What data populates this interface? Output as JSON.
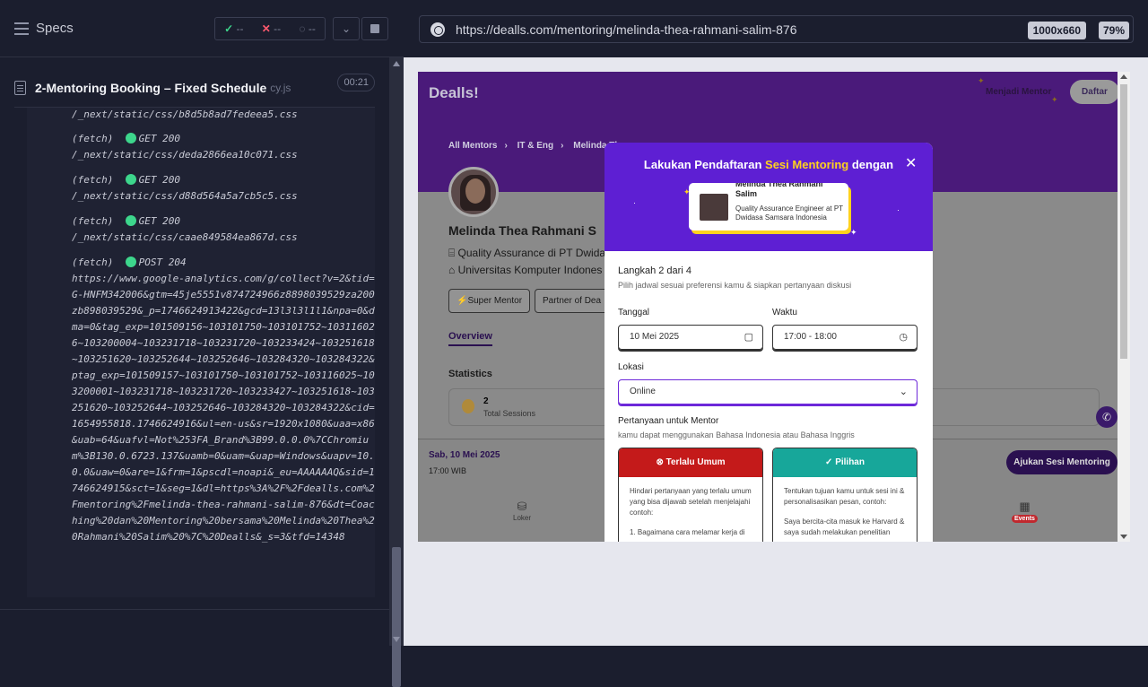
{
  "runner": {
    "specs_label": "Specs",
    "stats": {
      "passed": "--",
      "failed": "--",
      "pending": "--"
    },
    "spec": {
      "title": "2-Mentoring Booking – Fixed Schedule",
      "ext": "cy.js",
      "timer": "00:21"
    },
    "log_first": "/_next/static/css/b8d5b8ad7fedeea5.css",
    "log": [
      {
        "type": "(fetch)",
        "method": "GET 200",
        "url": "/_next/static/css/deda2866ea10c071.css"
      },
      {
        "type": "(fetch)",
        "method": "GET 200",
        "url": "/_next/static/css/d88d564a5a7cb5c5.css"
      },
      {
        "type": "(fetch)",
        "method": "GET 200",
        "url": "/_next/static/css/caae849584ea867d.css"
      },
      {
        "type": "(fetch)",
        "method": "POST 204",
        "url": "https://www.google-analytics.com/g/collect?v=2&tid=G-HNFM342006&gtm=45je5551v874724966z8898039529za200zb898039529&_p=1746624913422&gcd=13l3l3l1l1&npa=0&dma=0&tag_exp=101509156~103101750~103101752~103116026~103200004~103231718~103231720~103233424~103251618~103251620~103252644~103252646~103284320~103284322&ptag_exp=101509157~103101750~103101752~103116025~103200001~103231718~103231720~103233427~103251618~103251620~103252644~103252646~103284320~103284322&cid=1654955818.1746624916&ul=en-us&sr=1920x1080&uaa=x86&uab=64&uafvl=Not%253FA_Brand%3B99.0.0.0%7CChromium%3B130.0.6723.137&uamb=0&uam=&uap=Windows&uapv=10.0.0&uaw=0&are=1&frm=1&pscdl=noapi&_eu=AAAAAAQ&sid=1746624915&sct=1&seg=1&dl=https%3A%2F%2Fdealls.com%2Fmentoring%2Fmelinda-thea-rahmani-salim-876&dt=Coaching%20dan%20Mentoring%20bersama%20Melinda%20Thea%20Rahmani%20Salim%20%7C%20Dealls&_s=3&tfd=14348"
      }
    ]
  },
  "browser": {
    "url": "https://dealls.com/mentoring/melinda-thea-rahmani-salim-876",
    "viewport": "1000x660",
    "zoom": "79%"
  },
  "app": {
    "brand": "Dealls!",
    "become_mentor": "Menjadi Mentor",
    "daftar": "Daftar",
    "breadcrumb": [
      "All Mentors",
      "IT & Eng",
      "Melinda Th"
    ],
    "mentor_name": "Melinda Thea Rahmani S",
    "info1": "Quality Assurance di PT Dwida",
    "info2": "Universitas Komputer Indones",
    "badge_super": "Super Mentor",
    "badge_partner": "Partner of Dea",
    "overview_tab": "Overview",
    "statistics": "Statistics",
    "stat_value": "2",
    "stat_label": "Total Sessions",
    "selected_date": "Sab, 10 Mei 2025",
    "selected_time": "17:00 WIB",
    "ajukan": "Ajukan Sesi Mentoring",
    "nav_loker": "Loker",
    "nav_events": "Events"
  },
  "modal": {
    "title_pre": "Lakukan Pendaftaran",
    "title_hl": "Sesi Mentoring",
    "title_post": "dengan",
    "mentor_card_name": "Melinda Thea Rahmani Salim",
    "mentor_card_role": "Quality Assurance Engineer at PT Dwidasa Samsara Indonesia",
    "step": "Langkah 2 dari 4",
    "step_sub": "Pilih jadwal sesuai preferensi kamu & siapkan pertanyaan diskusi",
    "tanggal_label": "Tanggal",
    "tanggal_value": "10 Mei 2025",
    "waktu_label": "Waktu",
    "waktu_value": "17:00 - 18:00",
    "lokasi_label": "Lokasi",
    "lokasi_value": "Online",
    "q_title": "Pertanyaan untuk Mentor",
    "q_sub": "kamu dapat menggunakan Bahasa Indonesia atau Bahasa Inggris",
    "bad_title": "Terlalu Umum",
    "bad_body": "Hindari pertanyaan yang terlalu umum yang bisa dijawab setelah menjelajahi contoh:",
    "bad_example": "1. Bagaimana cara melamar kerja di",
    "good_title": "Pilihan",
    "good_body": "Tentukan tujuan kamu untuk sesi ini & personalisasikan pesan, contoh:",
    "good_example": "Saya bercita-cita masuk ke Harvard & saya sudah melakukan penelitian",
    "colors": {
      "purple": "#5e1fd3",
      "yellow": "#ffd21e",
      "red": "#c41a1a",
      "teal": "#17a79a"
    }
  }
}
